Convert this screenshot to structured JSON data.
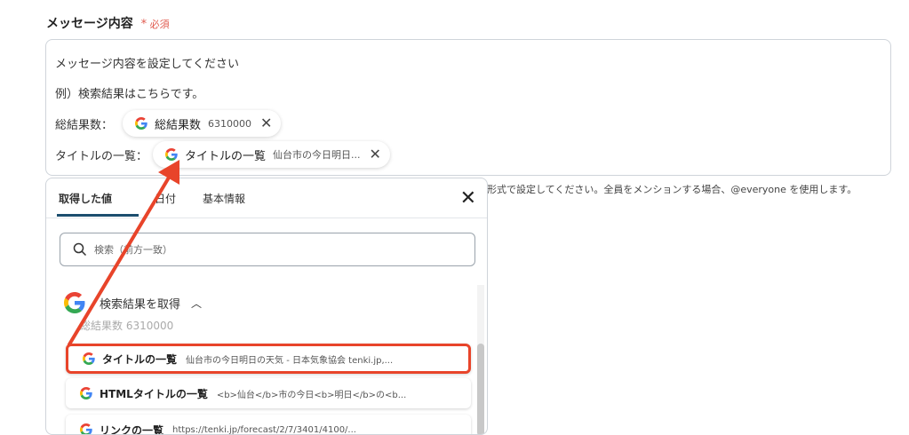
{
  "field": {
    "label": "メッセージ内容",
    "required_mark": "*",
    "required_label": "必須"
  },
  "editor": {
    "line1": "メッセージ内容を設定してください",
    "line2": "例）検索結果はこちらです。",
    "line3_label": "総結果数：",
    "chip1": {
      "name": "総結果数",
      "value": "6310000"
    },
    "line4_label": "タイトルの一覧：",
    "chip2": {
      "name": "タイトルの一覧",
      "value": "仙台市の今日明日..."
    }
  },
  "hint": "形式で設定してください。全員をメンションする場合、@everyone を使用します。",
  "panel": {
    "tabs": [
      "取得した値",
      "日付",
      "基本情報"
    ],
    "search_placeholder": "検索（前方一致）",
    "section_title": "検索結果を取得",
    "peek_item": "総結果数  6310000",
    "items": [
      {
        "name": "タイトルの一覧",
        "value": "仙台市の今日明日の天気 - 日本気象協会 tenki.jp,..."
      },
      {
        "name": "HTMLタイトルの一覧",
        "value": "<b>仙台</b>市の今日<b>明日</b>の<b..."
      },
      {
        "name": "リンクの一覧",
        "value": "https://tenki.jp/forecast/2/7/3401/4100/..."
      }
    ]
  },
  "colors": {
    "accent": "#1c4e6e",
    "highlight": "#e8442a",
    "required": "#e05a4e"
  },
  "icons": {
    "google": "google-g-logo",
    "close": "close-icon",
    "search": "search-icon",
    "chevron": "chevron-up-icon"
  }
}
